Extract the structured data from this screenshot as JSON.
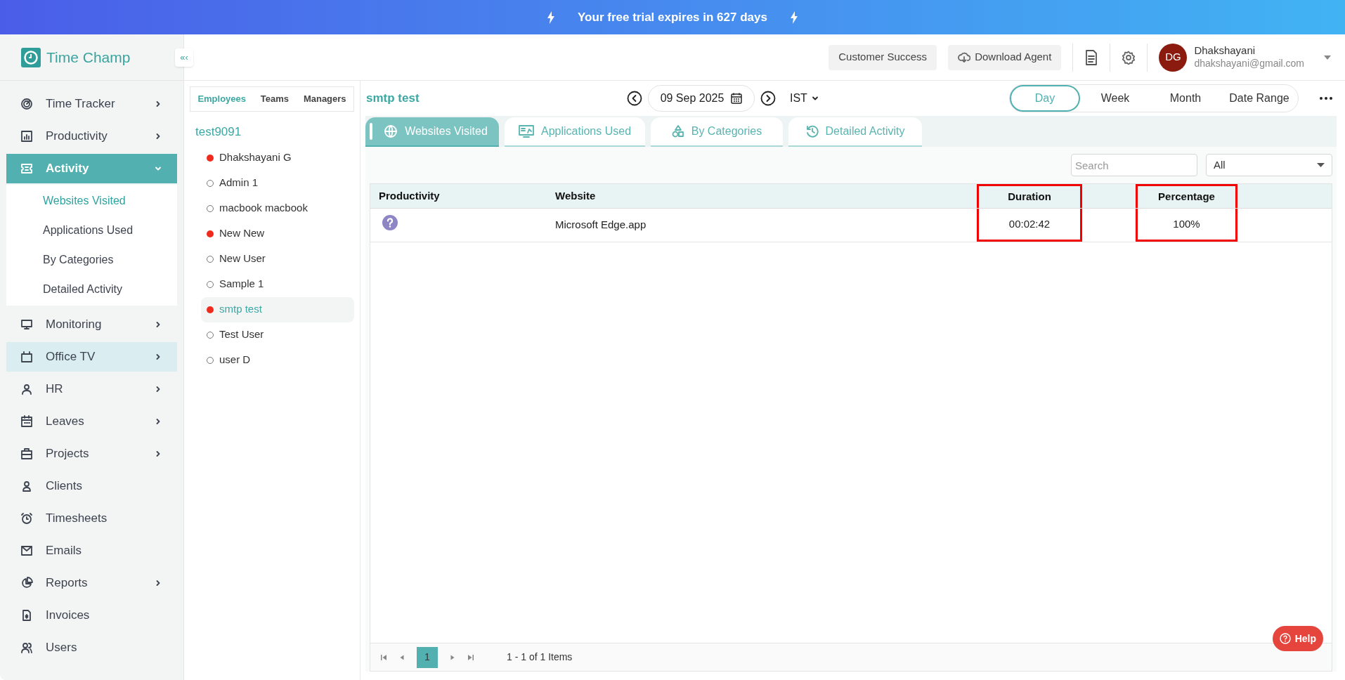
{
  "banner": {
    "text": "Your free trial expires in 627 days"
  },
  "header": {
    "logo": "Time Champ",
    "collapse": "«‹",
    "buttons": [
      "Customer Success",
      "Download Agent"
    ],
    "user": {
      "initials": "DG",
      "name": "Dhakshayani",
      "email": "dhakshayani@gmail.com"
    }
  },
  "sidebar": {
    "items": [
      {
        "label": "Time Tracker",
        "has_submenu": true,
        "expanded": false,
        "selected": false,
        "hovered": false
      },
      {
        "label": "Productivity",
        "has_submenu": true,
        "expanded": false,
        "selected": false,
        "hovered": false
      },
      {
        "label": "Activity",
        "has_submenu": true,
        "expanded": true,
        "selected": true,
        "hovered": false,
        "children": [
          {
            "label": "Websites Visited",
            "selected": true
          },
          {
            "label": "Applications Used",
            "selected": false
          },
          {
            "label": "By Categories",
            "selected": false
          },
          {
            "label": "Detailed Activity",
            "selected": false
          }
        ]
      },
      {
        "label": "Monitoring",
        "has_submenu": true,
        "expanded": false,
        "selected": false,
        "hovered": false
      },
      {
        "label": "Office TV",
        "has_submenu": true,
        "expanded": false,
        "selected": false,
        "hovered": true
      },
      {
        "label": "HR",
        "has_submenu": true,
        "expanded": false,
        "selected": false,
        "hovered": false
      },
      {
        "label": "Leaves",
        "has_submenu": true,
        "expanded": false,
        "selected": false,
        "hovered": false
      },
      {
        "label": "Projects",
        "has_submenu": true,
        "expanded": false,
        "selected": false,
        "hovered": false
      },
      {
        "label": "Clients",
        "has_submenu": false,
        "expanded": false,
        "selected": false,
        "hovered": false
      },
      {
        "label": "Timesheets",
        "has_submenu": false,
        "expanded": false,
        "selected": false,
        "hovered": false
      },
      {
        "label": "Emails",
        "has_submenu": false,
        "expanded": false,
        "selected": false,
        "hovered": false
      },
      {
        "label": "Reports",
        "has_submenu": true,
        "expanded": false,
        "selected": false,
        "hovered": false
      },
      {
        "label": "Invoices",
        "has_submenu": false,
        "expanded": false,
        "selected": false,
        "hovered": false
      },
      {
        "label": "Users",
        "has_submenu": false,
        "expanded": false,
        "selected": false,
        "hovered": false
      }
    ]
  },
  "people_panel": {
    "tabs": [
      {
        "label": "Employees",
        "selected": true
      },
      {
        "label": "Teams",
        "selected": false
      },
      {
        "label": "Managers",
        "selected": false
      }
    ],
    "group": "test9091",
    "employees": [
      {
        "name": "Dhakshayani G",
        "online": true,
        "selected": false
      },
      {
        "name": "Admin 1",
        "online": false,
        "selected": false
      },
      {
        "name": "macbook macbook",
        "online": false,
        "selected": false
      },
      {
        "name": "New New",
        "online": true,
        "selected": false
      },
      {
        "name": "New User",
        "online": false,
        "selected": false
      },
      {
        "name": "Sample 1",
        "online": false,
        "selected": false
      },
      {
        "name": "smtp test",
        "online": true,
        "selected": true
      },
      {
        "name": "Test User",
        "online": false,
        "selected": false
      },
      {
        "name": "user D",
        "online": false,
        "selected": false
      }
    ]
  },
  "main": {
    "title": "smtp test",
    "date": "09 Sep 2025",
    "timezone": "IST",
    "ranges": [
      {
        "label": "Day",
        "selected": true
      },
      {
        "label": "Week",
        "selected": false
      },
      {
        "label": "Month",
        "selected": false
      },
      {
        "label": "Date Range",
        "selected": false
      }
    ],
    "tabs": [
      {
        "label": "Websites Visited",
        "selected": true
      },
      {
        "label": "Applications Used",
        "selected": false
      },
      {
        "label": "By Categories",
        "selected": false
      },
      {
        "label": "Detailed Activity",
        "selected": false
      }
    ],
    "search": {
      "placeholder": "Search"
    },
    "filter": "All",
    "table": {
      "columns": [
        {
          "label": "Productivity",
          "highlighted": false
        },
        {
          "label": "Website",
          "highlighted": false
        },
        {
          "label": "Duration",
          "highlighted": true
        },
        {
          "label": "Percentage",
          "highlighted": true
        }
      ],
      "rows": [
        {
          "website": "Microsoft Edge.app",
          "duration": "00:02:42",
          "percentage": "100%"
        }
      ]
    },
    "pagination": {
      "pages": [
        {
          "label": "1",
          "selected": true
        }
      ],
      "summary": "1 - 1 of 1 Items"
    },
    "help": "Help"
  }
}
